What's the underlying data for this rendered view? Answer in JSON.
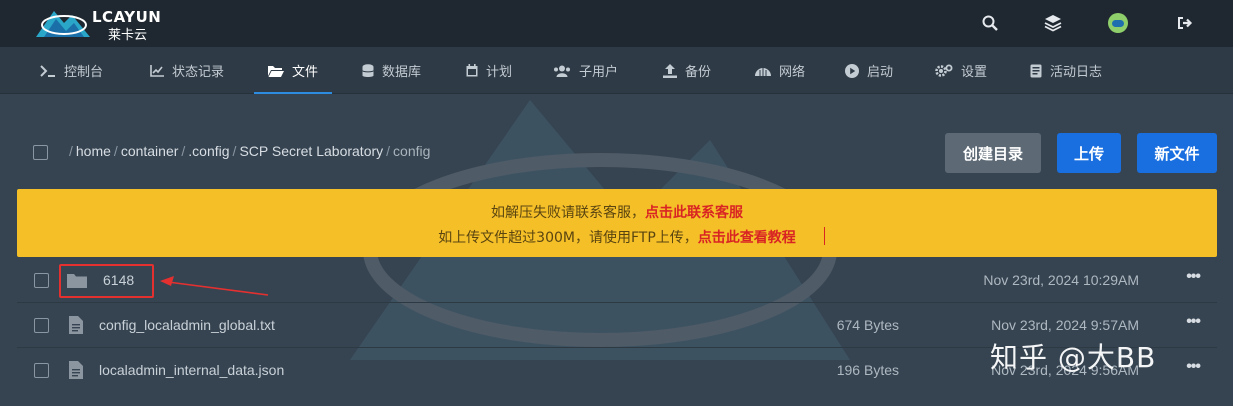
{
  "brand": {
    "name": "LCAYUN",
    "subtitle": "莱卡云"
  },
  "nav": [
    {
      "label": "控制台",
      "icon": "terminal-icon"
    },
    {
      "label": "状态记录",
      "icon": "chart-icon"
    },
    {
      "label": "文件",
      "icon": "folder-open-icon",
      "active": true
    },
    {
      "label": "数据库",
      "icon": "database-icon"
    },
    {
      "label": "计划",
      "icon": "calendar-icon"
    },
    {
      "label": "子用户",
      "icon": "users-icon"
    },
    {
      "label": "备份",
      "icon": "upload-icon"
    },
    {
      "label": "网络",
      "icon": "network-icon"
    },
    {
      "label": "启动",
      "icon": "play-icon"
    },
    {
      "label": "设置",
      "icon": "gear-icon"
    },
    {
      "label": "活动日志",
      "icon": "log-icon"
    }
  ],
  "breadcrumb": {
    "root_sep": "/",
    "segments": [
      "home",
      "container",
      ".config",
      "SCP Secret Laboratory",
      "config"
    ]
  },
  "actions": {
    "create_dir": "创建目录",
    "upload": "上传",
    "new_file": "新文件"
  },
  "alert": {
    "line1_text": "如解压失败请联系客服，",
    "line1_link": "点击此联系客服",
    "line2_text": "如上传文件超过300M，请使用FTP上传，",
    "line2_link": "点击此查看教程"
  },
  "files": [
    {
      "name": "6148",
      "type": "folder",
      "size": "",
      "date": "Nov 23rd, 2024 10:29AM"
    },
    {
      "name": "config_localadmin_global.txt",
      "type": "file",
      "size": "674 Bytes",
      "date": "Nov 23rd, 2024 9:57AM"
    },
    {
      "name": "localadmin_internal_data.json",
      "type": "file",
      "size": "196 Bytes",
      "date": "Nov 23rd, 2024 9:56AM"
    }
  ],
  "more_glyph": "•••",
  "watermark": "知乎 @大BB",
  "colors": {
    "accent": "#1a6fe0",
    "alert_bg": "#f5bf28",
    "alert_link": "#d92424",
    "highlight": "#e53030"
  }
}
